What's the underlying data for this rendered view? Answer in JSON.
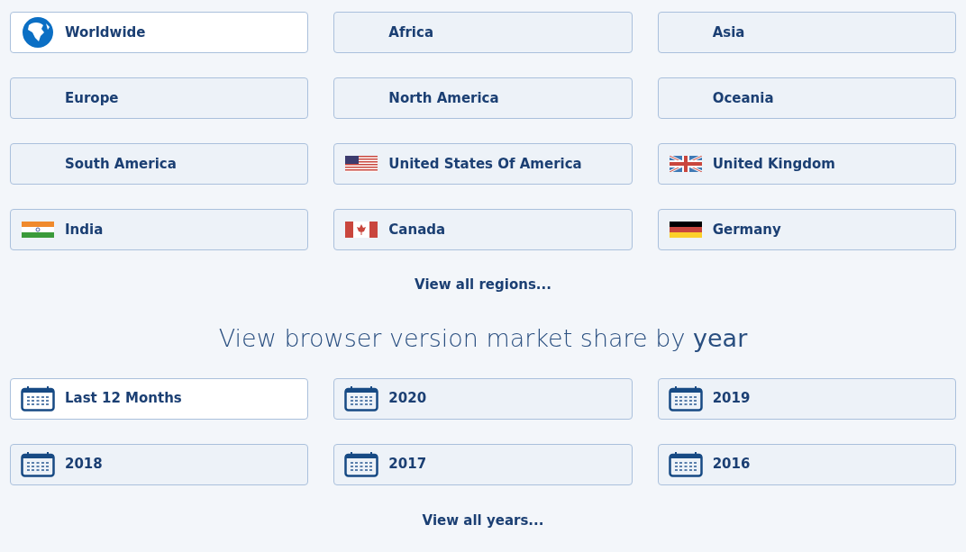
{
  "regions": [
    {
      "label": "Worldwide",
      "kind": "globe",
      "selected": true
    },
    {
      "label": "Africa",
      "kind": "plain",
      "selected": false
    },
    {
      "label": "Asia",
      "kind": "plain",
      "selected": false
    },
    {
      "label": "Europe",
      "kind": "plain",
      "selected": false
    },
    {
      "label": "North America",
      "kind": "plain",
      "selected": false
    },
    {
      "label": "Oceania",
      "kind": "plain",
      "selected": false
    },
    {
      "label": "South America",
      "kind": "plain",
      "selected": false
    },
    {
      "label": "United States Of America",
      "kind": "us",
      "selected": false
    },
    {
      "label": "United Kingdom",
      "kind": "uk",
      "selected": false
    },
    {
      "label": "India",
      "kind": "india",
      "selected": false
    },
    {
      "label": "Canada",
      "kind": "canada",
      "selected": false
    },
    {
      "label": "Germany",
      "kind": "germany",
      "selected": false
    }
  ],
  "regions_link": "View all regions...",
  "years_heading": "View browser version market share by **year**",
  "years": [
    {
      "label": "Last 12 Months",
      "kind": "calendar",
      "selected": true
    },
    {
      "label": "2020",
      "kind": "calendar",
      "selected": false
    },
    {
      "label": "2019",
      "kind": "calendar",
      "selected": false
    },
    {
      "label": "2018",
      "kind": "calendar",
      "selected": false
    },
    {
      "label": "2017",
      "kind": "calendar",
      "selected": false
    },
    {
      "label": "2016",
      "kind": "calendar",
      "selected": false
    }
  ],
  "years_link": "View all years..."
}
